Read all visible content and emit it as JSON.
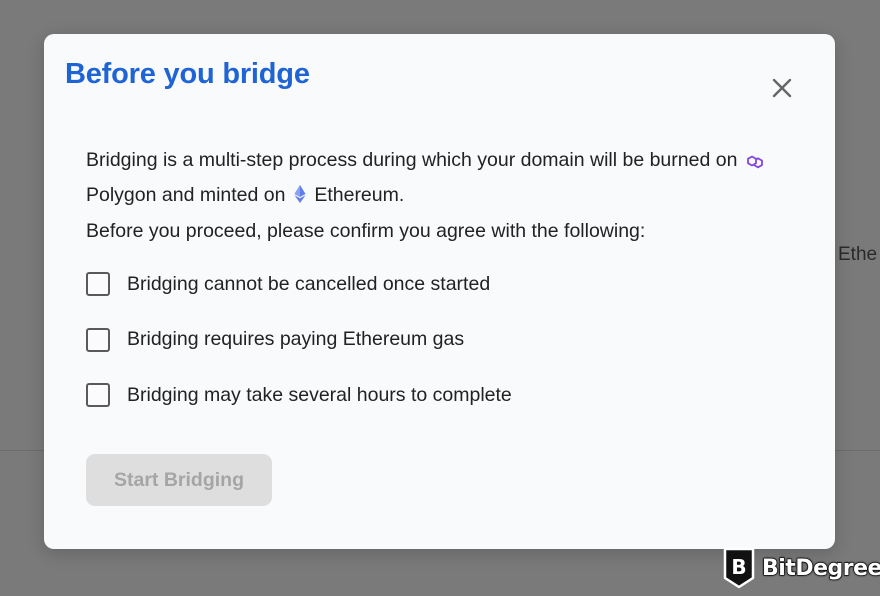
{
  "background": {
    "peek_text": "Ethe"
  },
  "modal": {
    "title": "Before you bridge",
    "close_icon": "close-icon",
    "intro_part1": "Bridging is a multi-step process during which your domain will be burned on",
    "source_chain": {
      "name": "Polygon",
      "icon": "polygon-icon",
      "color": "#8247e5"
    },
    "intro_part2": "and minted on",
    "target_chain": {
      "name": "Ethereum",
      "icon": "ethereum-icon",
      "color": "#627eea"
    },
    "intro_end": ".",
    "confirm_prompt": "Before you proceed, please confirm you agree with the following:",
    "checkboxes": [
      {
        "label": "Bridging cannot be cancelled once started",
        "checked": false
      },
      {
        "label": "Bridging requires paying Ethereum gas",
        "checked": false
      },
      {
        "label": "Bridging may take several hours to complete",
        "checked": false
      }
    ],
    "start_button": {
      "label": "Start Bridging",
      "disabled": true
    },
    "accent_color": "#1f64d4"
  },
  "watermark": {
    "brand": "BitDegree",
    "logo_letter": "B"
  }
}
